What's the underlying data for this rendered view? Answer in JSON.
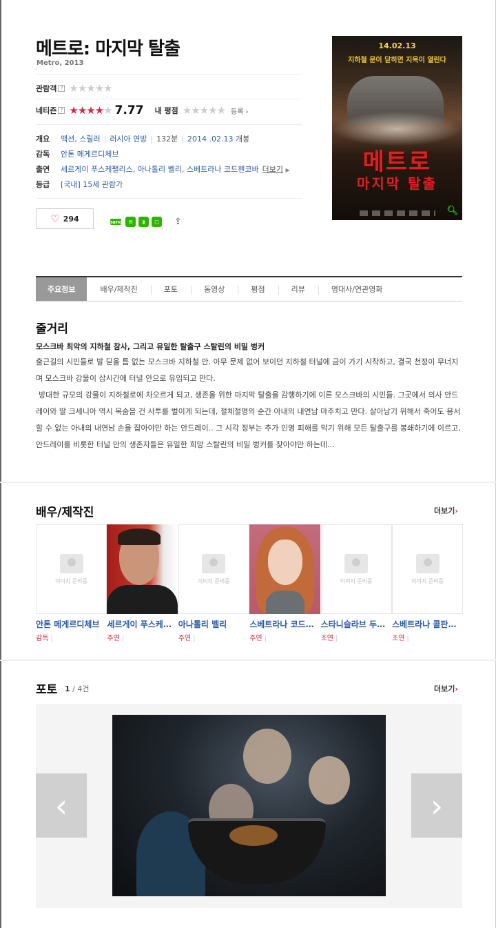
{
  "movie": {
    "title": "메트로: 마지막 탈출",
    "subtitle": "Metro, 2013"
  },
  "ratings": {
    "audience_label": "관람객",
    "audience_help": "?",
    "netizen_label": "네티즌",
    "netizen_help": "?",
    "netizen_stars_filled": 4,
    "netizen_score": "7.77",
    "my_rating_label": "내 평점",
    "register_label": "등록",
    "chevron": "›"
  },
  "info": {
    "overview_label": "개요",
    "genre": "액션, 스릴러",
    "country": "러시아 연방",
    "runtime": "132분",
    "release_date": "2014 .02.13",
    "release_suffix": "개봉",
    "director_label": "감독",
    "director": "안톤 메게르디체브",
    "cast_label": "출연",
    "cast": "세르게이 푸스케팰리스, 아나톨리 벨리, 스베트라나 코드첸코바",
    "cast_more": "더보기",
    "grade_label": "등급",
    "grade": "[국내] 15세 관람가"
  },
  "actions": {
    "like_count": "294",
    "share_icons": [
      "band-icon",
      "line-icon",
      "bookmark-icon",
      "naver-icon"
    ]
  },
  "poster": {
    "date": "14.02.13",
    "tagline": "지하철 문이 닫히면 지옥이 열린다",
    "title_line1": "메트로",
    "title_line2": "마지막 탈출"
  },
  "tabs": [
    {
      "label": "주요정보",
      "active": true
    },
    {
      "label": "배우/제작진"
    },
    {
      "label": "포토"
    },
    {
      "label": "동영상"
    },
    {
      "label": "평점"
    },
    {
      "label": "리뷰"
    },
    {
      "label": "명대사/연관영화"
    }
  ],
  "synopsis": {
    "title": "줄거리",
    "headline": "모스크바 최악의 지하철 참사, 그리고 유일한 탈출구 스탈린의 비밀 벙커",
    "body_p1": "출근길의 시민들로 발 딛을 틈 없는 모스크바 지하철 안. 아무 문제 없어 보이던 지하철 터널에 금이 가기 시작하고, 결국 천정이 무너지며 모스크바 강물이 삽시간에 터널 안으로 유입되고 만다.",
    "body_p2": "방대한 규모의 강물이 지하철로에 차오르게 되고, 생존을 위한 마지막 탈출을 감행하기에 이른 모스크바의 시민들. 그곳에서 의사 안드레이와 딸 크세니아 역시 목숨을 건 사투를 벌이게 되는데, 절체절명의 순간 아내의 내연남 마주치고 만다. 살아남기 위해서 죽어도 용서할 수 없는 아내의 내연남 손을 잡아야만 하는 안드레이.. 그 시각 정부는 추가 인명 피해를 막기 위해 모든 탈출구를 봉쇄하기에 이르고, 안드레이를 비롯한 터널 안의 생존자들은 유일한 희망 스탈린의 비밀 벙커를 찾아야만 하는데..."
  },
  "cast_section": {
    "title": "배우/제작진",
    "more": "더보기",
    "placeholder_text": "이미지 준비중",
    "members": [
      {
        "name": "안톤 메게르디체브",
        "role": "감독",
        "photo": "none"
      },
      {
        "name": "세르게이 푸스케팰리스",
        "role": "주연",
        "photo": "man"
      },
      {
        "name": "아나톨리 벨리",
        "role": "주연",
        "photo": "none"
      },
      {
        "name": "스베트라나 코드첸코바",
        "role": "주연",
        "photo": "woman"
      },
      {
        "name": "스타니슬라브 두즈니코프",
        "role": "조연",
        "photo": "none"
      },
      {
        "name": "스베트라나 콜판코바",
        "role": "조연",
        "photo": "none"
      }
    ]
  },
  "photo_section": {
    "title": "포토",
    "current": "1",
    "total": "/ 4건",
    "more": "더보기",
    "prev": "‹",
    "next": "›"
  }
}
